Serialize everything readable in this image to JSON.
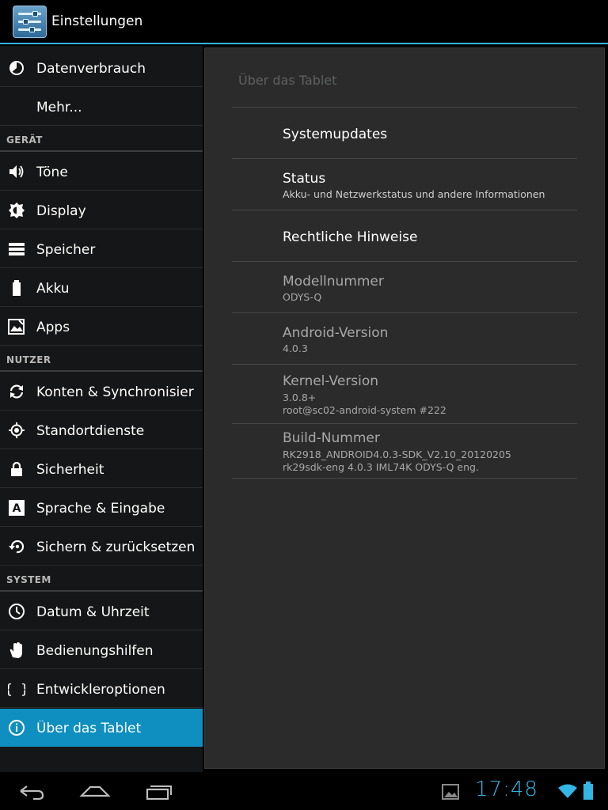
{
  "app": {
    "title": "Einstellungen",
    "accent_color": "#33b5e5",
    "icon": "settings-sliders-icon"
  },
  "sidebar": {
    "items": [
      {
        "type": "item",
        "label": "Datenverbrauch",
        "icon": "data-usage-icon"
      },
      {
        "type": "item",
        "label": "Mehr...",
        "icon": ""
      },
      {
        "type": "section",
        "label": "GERÄT"
      },
      {
        "type": "item",
        "label": "Töne",
        "icon": "speaker-icon"
      },
      {
        "type": "item",
        "label": "Display",
        "icon": "brightness-icon"
      },
      {
        "type": "item",
        "label": "Speicher",
        "icon": "storage-icon"
      },
      {
        "type": "item",
        "label": "Akku",
        "icon": "battery-icon"
      },
      {
        "type": "item",
        "label": "Apps",
        "icon": "apps-icon"
      },
      {
        "type": "section",
        "label": "NUTZER"
      },
      {
        "type": "item",
        "label": "Konten & Synchronisieru",
        "icon": "sync-icon"
      },
      {
        "type": "item",
        "label": "Standortdienste",
        "icon": "location-icon"
      },
      {
        "type": "item",
        "label": "Sicherheit",
        "icon": "lock-icon"
      },
      {
        "type": "item",
        "label": "Sprache & Eingabe",
        "icon": "language-icon"
      },
      {
        "type": "item",
        "label": "Sichern & zurücksetzen",
        "icon": "backup-icon"
      },
      {
        "type": "section",
        "label": "SYSTEM"
      },
      {
        "type": "item",
        "label": "Datum & Uhrzeit",
        "icon": "clock-icon"
      },
      {
        "type": "item",
        "label": "Bedienungshilfen",
        "icon": "hand-icon"
      },
      {
        "type": "item",
        "label": "Entwickleroptionen",
        "icon": "braces-icon"
      },
      {
        "type": "item",
        "label": "Über das Tablet",
        "icon": "info-icon",
        "active": true
      }
    ]
  },
  "detail": {
    "breadcrumb": "Über das Tablet",
    "prefs": [
      {
        "title": "Systemupdates",
        "summary": [],
        "enabled": true
      },
      {
        "title": "Status",
        "summary": [
          "Akku- und Netzwerkstatus und andere Informationen"
        ],
        "enabled": true
      },
      {
        "title": "Rechtliche Hinweise",
        "summary": [],
        "enabled": true
      },
      {
        "title": "Modellnummer",
        "summary": [
          "ODYS-Q"
        ],
        "enabled": false
      },
      {
        "title": "Android-Version",
        "summary": [
          "4.0.3"
        ],
        "enabled": false
      },
      {
        "title": "Kernel-Version",
        "summary": [
          "3.0.8+",
          "root@sc02-android-system #222"
        ],
        "enabled": false
      },
      {
        "title": "Build-Nummer",
        "summary": [
          "RK2918_ANDROID4.0.3-SDK_V2.10_20120205",
          "rk29sdk-eng 4.0.3 IML74K ODYS-Q eng."
        ],
        "enabled": false
      }
    ]
  },
  "navbar": {
    "back_icon": "back-icon",
    "home_icon": "home-icon",
    "recents_icon": "recent-apps-icon",
    "clock": "17:48",
    "status_icons": [
      "gallery-notification-icon",
      "wifi-icon",
      "battery-icon"
    ]
  }
}
